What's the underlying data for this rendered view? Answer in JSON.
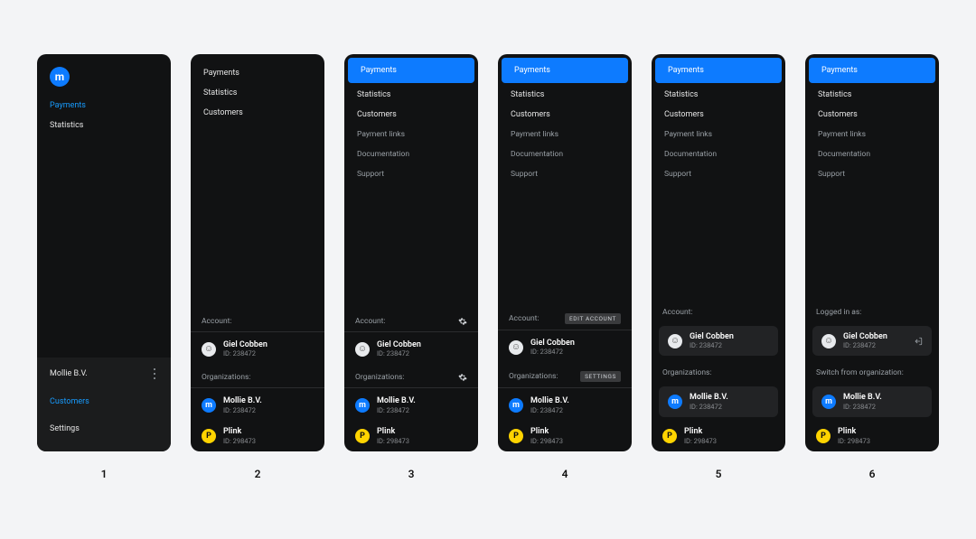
{
  "brand": {
    "letter": "m"
  },
  "nav": {
    "payments": "Payments",
    "statistics": "Statistics",
    "customers": "Customers",
    "payment_links": "Payment links",
    "documentation": "Documentation",
    "support": "Support",
    "settings": "Settings"
  },
  "labels": {
    "account": "Account:",
    "organizations": "Organizations:",
    "edit_account": "EDIT ACCOUNT",
    "settings_chip": "SETTINGS",
    "logged_in_as": "Logged in as:",
    "switch_from_org": "Switch from organization:"
  },
  "user": {
    "name": "Giel Cobben",
    "id_label": "ID: 238472"
  },
  "orgs": [
    {
      "key": "mollie",
      "name": "Mollie B.V.",
      "id_label": "ID: 238472",
      "icon": "m",
      "icon_letter": "m"
    },
    {
      "key": "plink",
      "name": "Plink",
      "id_label": "ID: 298473",
      "icon": "p",
      "icon_letter": "P"
    }
  ],
  "captions": [
    "1",
    "2",
    "3",
    "4",
    "5",
    "6"
  ]
}
